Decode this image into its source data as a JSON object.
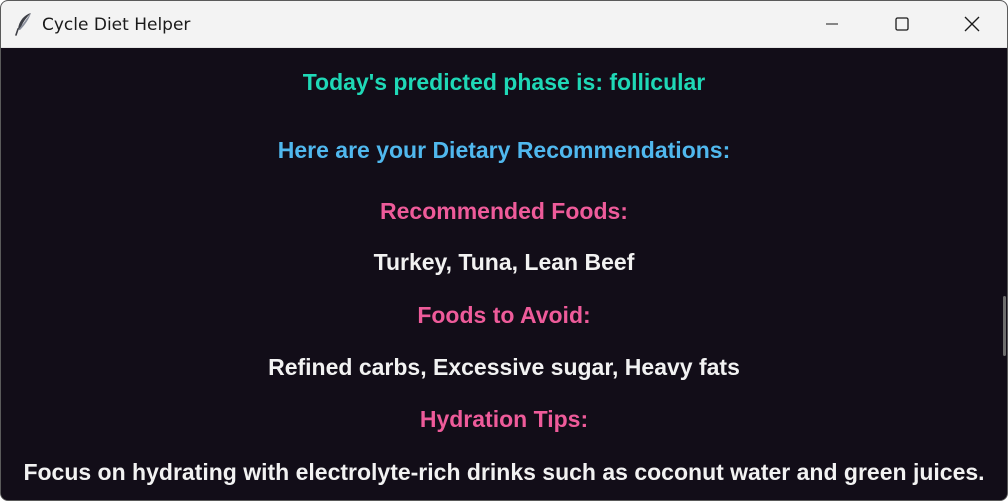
{
  "window": {
    "title": "Cycle Diet Helper",
    "icon": "feather-icon",
    "controls": [
      "minimize-icon",
      "maximize-icon",
      "close-icon"
    ]
  },
  "colors": {
    "background": "#120d18",
    "phase_text": "#1fd8b6",
    "intro_text": "#50b8ee",
    "heading_text": "#ee5b9a",
    "body_text": "#f2f2f2"
  },
  "content": {
    "phase_line": "Today's predicted phase is: follicular",
    "intro": "Here are your Dietary Recommendations:",
    "recommended_heading": "Recommended Foods:",
    "recommended_items": "Turkey, Tuna, Lean Beef",
    "avoid_heading": "Foods to Avoid:",
    "avoid_items": "Refined carbs, Excessive sugar, Heavy fats",
    "hydration_heading": "Hydration Tips:",
    "hydration_tip": "Focus on hydrating with electrolyte-rich drinks such as coconut water and green juices."
  }
}
